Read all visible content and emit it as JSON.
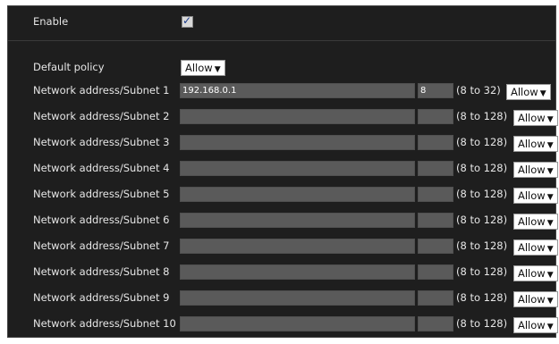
{
  "enable": {
    "label": "Enable",
    "checked": true,
    "check_glyph": "✓"
  },
  "default_policy": {
    "label": "Default policy",
    "value": "Allow",
    "caret": "▼"
  },
  "rows": [
    {
      "label": "Network address/Subnet 1",
      "address": "192.168.0.1",
      "mask": "8",
      "range": "(8 to 32)",
      "policy": "Allow"
    },
    {
      "label": "Network address/Subnet 2",
      "address": "",
      "mask": "",
      "range": "(8 to 128)",
      "policy": "Allow"
    },
    {
      "label": "Network address/Subnet 3",
      "address": "",
      "mask": "",
      "range": "(8 to 128)",
      "policy": "Allow"
    },
    {
      "label": "Network address/Subnet 4",
      "address": "",
      "mask": "",
      "range": "(8 to 128)",
      "policy": "Allow"
    },
    {
      "label": "Network address/Subnet 5",
      "address": "",
      "mask": "",
      "range": "(8 to 128)",
      "policy": "Allow"
    },
    {
      "label": "Network address/Subnet 6",
      "address": "",
      "mask": "",
      "range": "(8 to 128)",
      "policy": "Allow"
    },
    {
      "label": "Network address/Subnet 7",
      "address": "",
      "mask": "",
      "range": "(8 to 128)",
      "policy": "Allow"
    },
    {
      "label": "Network address/Subnet 8",
      "address": "",
      "mask": "",
      "range": "(8 to 128)",
      "policy": "Allow"
    },
    {
      "label": "Network address/Subnet 9",
      "address": "",
      "mask": "",
      "range": "(8 to 128)",
      "policy": "Allow"
    },
    {
      "label": "Network address/Subnet 10",
      "address": "",
      "mask": "",
      "range": "(8 to 128)",
      "policy": "Allow"
    }
  ],
  "caret": "▼",
  "colors": {
    "panel_bg": "#1e1e1e",
    "field_bg": "#5a5a5a",
    "text": "#e6e6e6",
    "select_bg": "#ffffff"
  }
}
